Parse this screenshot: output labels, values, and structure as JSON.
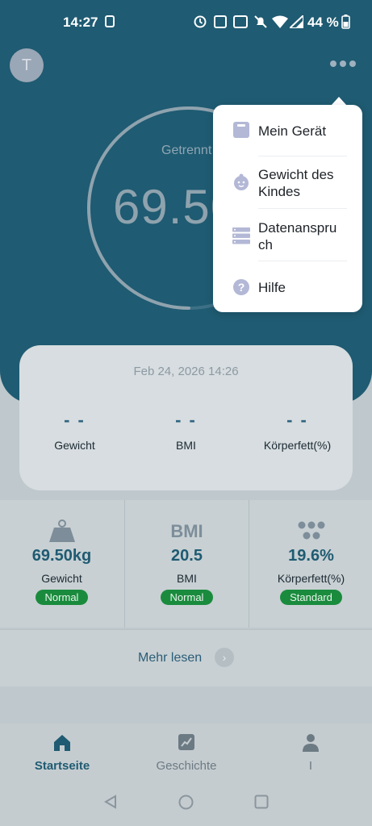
{
  "status_bar": {
    "time": "14:27",
    "battery": "44 %",
    "icons": [
      "sim-icon",
      "alarm-icon",
      "nfc-icon",
      "volte-icon",
      "mute-icon",
      "wifi-icon",
      "signal-icon",
      "battery-icon"
    ]
  },
  "header": {
    "avatar_letter": "T",
    "more_icon": "more-horizontal-icon"
  },
  "gauge": {
    "status": "Getrennt",
    "weight": "69.50",
    "progress": 0.75
  },
  "summary_card": {
    "date": "Feb 24, 2026 14:26",
    "columns": [
      {
        "value": "- -",
        "label": "Gewicht"
      },
      {
        "value": "- -",
        "label": "BMI"
      },
      {
        "value": "- -",
        "label": "Körperfett(%)"
      }
    ]
  },
  "metrics": [
    {
      "icon": "weight-icon",
      "value": "69.50kg",
      "label": "Gewicht",
      "badge": "Normal"
    },
    {
      "icon_text": "BMI",
      "value": "20.5",
      "label": "BMI",
      "badge": "Normal"
    },
    {
      "icon": "body-fat-icon",
      "value": "19.6%",
      "label": "Körperfett(%)",
      "badge": "Standard"
    }
  ],
  "more": {
    "label": "Mehr lesen"
  },
  "bottom_nav": [
    {
      "label": "Startseite",
      "active": true
    },
    {
      "label": "Geschichte",
      "active": false
    },
    {
      "label": "I",
      "active": false
    }
  ],
  "popup_menu": [
    {
      "icon": "scale-icon",
      "label_lines": [
        "Mein Gerät"
      ]
    },
    {
      "icon": "baby-icon",
      "label_lines": [
        "Gewicht des",
        "Kindes"
      ]
    },
    {
      "icon": "database-icon",
      "label_lines": [
        "Datenanspru",
        "ch"
      ]
    },
    {
      "icon": "help-icon",
      "label_lines": [
        "Hilfe"
      ]
    }
  ],
  "colors": {
    "primary": "#1f5b72",
    "badge_green": "#1a8b3d",
    "menu_icon": "#b3b8d6"
  }
}
